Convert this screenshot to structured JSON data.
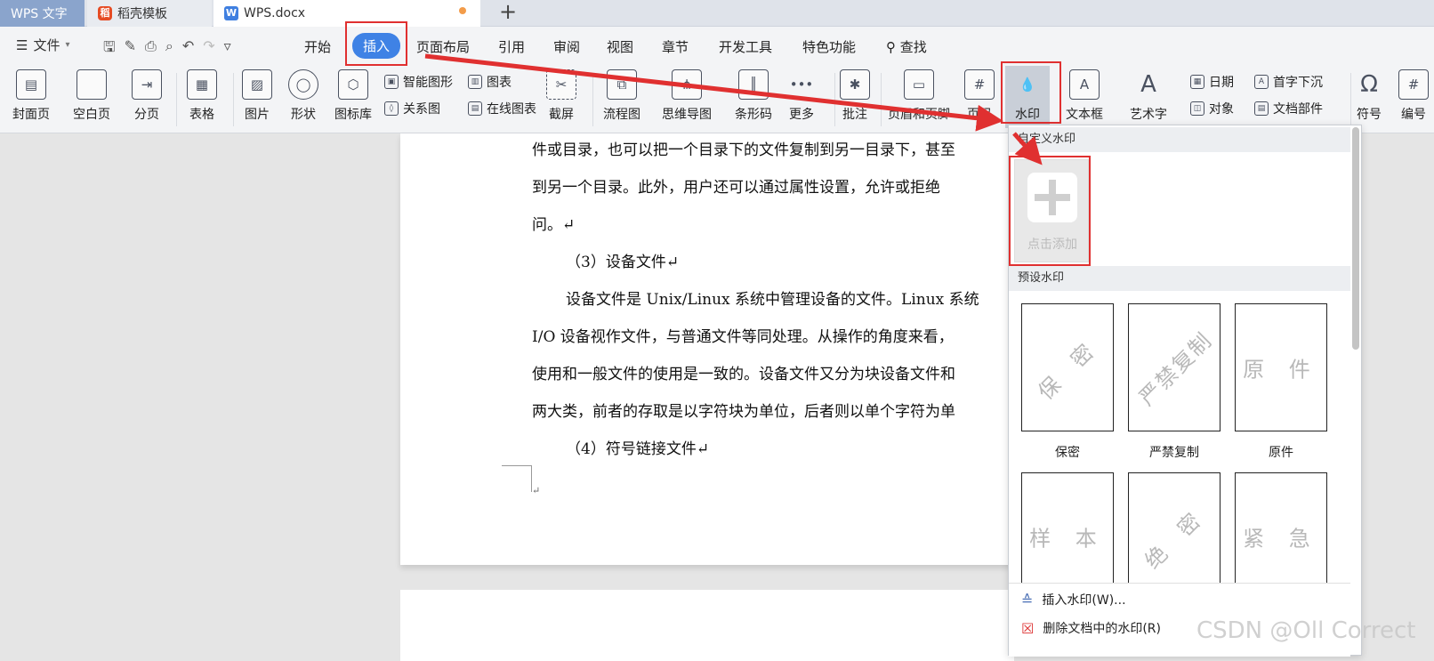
{
  "tabs": {
    "app_name": "WPS 文字",
    "template_tab": "稻壳模板",
    "doc_tab": "WPS.docx",
    "new_tab": "+"
  },
  "menu": {
    "file": "文件",
    "items": [
      "开始",
      "插入",
      "页面布局",
      "引用",
      "审阅",
      "视图",
      "章节",
      "开发工具",
      "特色功能",
      "查找"
    ],
    "active": "插入"
  },
  "ribbon": {
    "cover_page": "封面页",
    "blank_page": "空白页",
    "page_break": "分页",
    "table": "表格",
    "picture": "图片",
    "shape": "形状",
    "icon_library": "图标库",
    "smart_art": "智能图形",
    "chart": "图表",
    "relation_chart": "关系图",
    "online_chart": "在线图表",
    "screenshot": "截屏",
    "flowchart": "流程图",
    "mindmap": "思维导图",
    "barcode": "条形码",
    "more": "更多",
    "comment": "批注",
    "header_footer": "页眉和页脚",
    "page_number": "页码",
    "watermark": "水印",
    "textbox": "文本框",
    "wordart": "艺术字",
    "date": "日期",
    "dropcap": "首字下沉",
    "object": "对象",
    "doc_parts": "文档部件",
    "symbol": "符号",
    "numbering": "编号"
  },
  "document": {
    "lines": [
      "件或目录，也可以把一个目录下的文件复制到另一目录下，甚至",
      "到另一个目录。此外，用户还可以通过属性设置，允许或拒绝",
      "问。↵",
      "（3）设备文件↵",
      "设备文件是 Unix/Linux 系统中管理设备的文件。Linux 系统",
      "I/O 设备视作文件，与普通文件等同处理。从操作的角度来看，",
      "使用和一般文件的使用是一致的。设备文件又分为块设备文件和",
      "两大类，前者的存取是以字符块为单位，后者则以单个字符为单",
      "（4）符号链接文件↵",
      "↵"
    ]
  },
  "watermark_panel": {
    "custom_header": "自定义水印",
    "add_label": "点击添加",
    "preset_header": "预设水印",
    "presets": [
      {
        "text": "保 密",
        "caption": "保密",
        "style": "tilt"
      },
      {
        "text": "严禁复制",
        "caption": "严禁复制",
        "style": "tilt"
      },
      {
        "text": "原 件",
        "caption": "原件",
        "style": "flat"
      },
      {
        "text": "样 本",
        "caption": "",
        "style": "flat"
      },
      {
        "text": "绝 密",
        "caption": "",
        "style": "tilt"
      },
      {
        "text": "紧 急",
        "caption": "",
        "style": "flat"
      }
    ],
    "insert_label": "插入水印(W)...",
    "delete_label": "删除文档中的水印(R)"
  },
  "overlay": {
    "site_watermark": "CSDN @Oll Correct",
    "arrow_color": "#e03030"
  }
}
